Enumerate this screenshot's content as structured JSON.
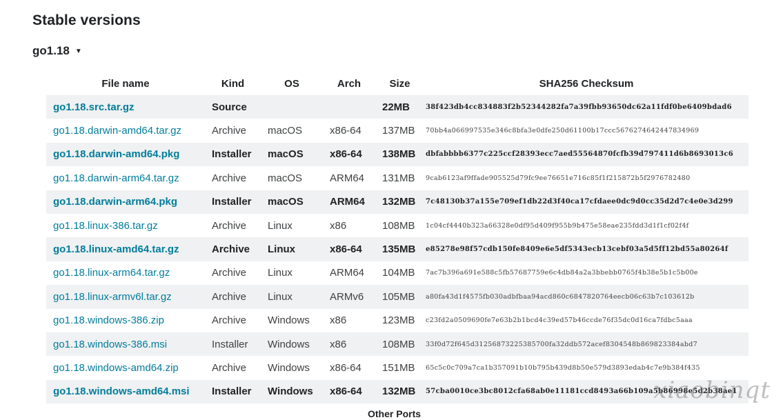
{
  "section_title": "Stable versions",
  "version": {
    "label": "go1.18",
    "caret": "▼"
  },
  "table": {
    "headers": [
      "File name",
      "Kind",
      "OS",
      "Arch",
      "Size",
      "SHA256 Checksum"
    ],
    "rows": [
      {
        "file": "go1.18.src.tar.gz",
        "kind": "Source",
        "os": "",
        "arch": "",
        "size": "22MB",
        "sha": "38f423db4cc834883f2b52344282fa7a39fbb93650dc62a11fdf0be6409bdad6",
        "highlight": true
      },
      {
        "file": "go1.18.darwin-amd64.tar.gz",
        "kind": "Archive",
        "os": "macOS",
        "arch": "x86-64",
        "size": "137MB",
        "sha": "70bb4a066997535e346c8bfa3e0dfe250d61100b17ccc5676274642447834969",
        "highlight": false
      },
      {
        "file": "go1.18.darwin-amd64.pkg",
        "kind": "Installer",
        "os": "macOS",
        "arch": "x86-64",
        "size": "138MB",
        "sha": "dbfabbbb6377c225ccf28393ecc7aed55564870fcfb39d797411d6b8693013c6",
        "highlight": true
      },
      {
        "file": "go1.18.darwin-arm64.tar.gz",
        "kind": "Archive",
        "os": "macOS",
        "arch": "ARM64",
        "size": "131MB",
        "sha": "9cab6123af9ffade905525d79fc9ee76651e716c85f1f215872b5f2976782480",
        "highlight": false
      },
      {
        "file": "go1.18.darwin-arm64.pkg",
        "kind": "Installer",
        "os": "macOS",
        "arch": "ARM64",
        "size": "132MB",
        "sha": "7c48130b37a155e709ef1db22d3f40ca17cfdaee0dc9d0cc35d2d7c4e0e3d299",
        "highlight": true
      },
      {
        "file": "go1.18.linux-386.tar.gz",
        "kind": "Archive",
        "os": "Linux",
        "arch": "x86",
        "size": "108MB",
        "sha": "1c04cf4440b323a66328e0df95d409f955b9b475e58eae235fdd3d1f1cf02f4f",
        "highlight": false
      },
      {
        "file": "go1.18.linux-amd64.tar.gz",
        "kind": "Archive",
        "os": "Linux",
        "arch": "x86-64",
        "size": "135MB",
        "sha": "e85278e98f57cdb150fe8409e6e5df5343ecb13cebf03a5d5ff12bd55a80264f",
        "highlight": true
      },
      {
        "file": "go1.18.linux-arm64.tar.gz",
        "kind": "Archive",
        "os": "Linux",
        "arch": "ARM64",
        "size": "104MB",
        "sha": "7ac7b396a691e588c5fb57687759e6c4db84a2a3bbebb0765f4b38e5b1c5b00e",
        "highlight": false
      },
      {
        "file": "go1.18.linux-armv6l.tar.gz",
        "kind": "Archive",
        "os": "Linux",
        "arch": "ARMv6",
        "size": "105MB",
        "sha": "a80fa43d1f4575fb030adbfbaa94acd860c6847820764eecb06c63b7c103612b",
        "highlight": false
      },
      {
        "file": "go1.18.windows-386.zip",
        "kind": "Archive",
        "os": "Windows",
        "arch": "x86",
        "size": "123MB",
        "sha": "c23fd2a0509690fe7e63b2b1bcd4c39ed57b46ccde76f35dc0d16ca7fdbc5aaa",
        "highlight": false
      },
      {
        "file": "go1.18.windows-386.msi",
        "kind": "Installer",
        "os": "Windows",
        "arch": "x86",
        "size": "108MB",
        "sha": "33f0d72f645d31256873225385700fa32ddb572acef8304548b869823384abd7",
        "highlight": false
      },
      {
        "file": "go1.18.windows-amd64.zip",
        "kind": "Archive",
        "os": "Windows",
        "arch": "x86-64",
        "size": "151MB",
        "sha": "65c5c0c709a7ca1b357091b10b795b439d8b50e579d3893edab4c7e9b384f435",
        "highlight": false
      },
      {
        "file": "go1.18.windows-amd64.msi",
        "kind": "Installer",
        "os": "Windows",
        "arch": "x86-64",
        "size": "132MB",
        "sha": "57cba0010ce3bc8012cfa68ab0e11181ccd8493a66b109a5b86998e5d2b38ae1",
        "highlight": true
      }
    ]
  },
  "other_ports": "Other Ports",
  "watermark": "xiaobinqt",
  "colors": {
    "link": "#007d9c",
    "row_shade": "#f0f1f2",
    "text": "#202224"
  }
}
